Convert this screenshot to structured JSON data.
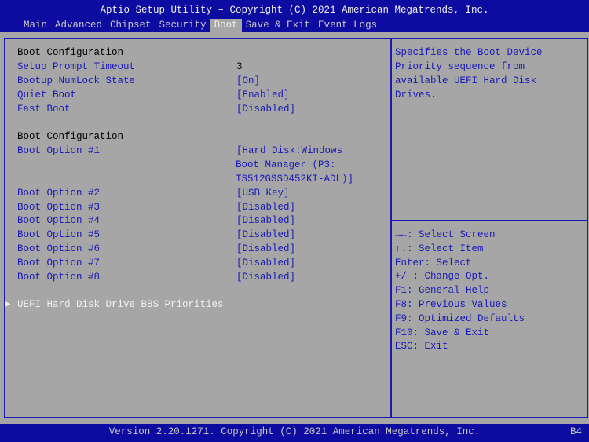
{
  "header": {
    "title": "Aptio Setup Utility – Copyright (C) 2021 American Megatrends, Inc.",
    "tabs": [
      "Main",
      "Advanced",
      "Chipset",
      "Security",
      "Boot",
      "Save & Exit",
      "Event Logs"
    ],
    "active_tab": "Boot"
  },
  "settings": [
    {
      "label": "Boot Configuration",
      "type": "heading"
    },
    {
      "label": "Setup Prompt Timeout",
      "value": "3"
    },
    {
      "label": "Bootup NumLock State",
      "value": "[On]"
    },
    {
      "label": "Quiet Boot",
      "value": "[Enabled]"
    },
    {
      "label": "Fast Boot",
      "value": "[Disabled]"
    },
    {
      "label": "Boot Configuration",
      "type": "heading"
    },
    {
      "label": "Boot Option #1",
      "value": "[Hard Disk:Windows",
      "value2": "Boot Manager (P3:",
      "value3": "TS512GSSD452KI-ADL)]"
    },
    {
      "label": "Boot Option #2",
      "value": "[USB Key]"
    },
    {
      "label": "Boot Option #3",
      "value": "[Disabled]"
    },
    {
      "label": "Boot Option #4",
      "value": "[Disabled]"
    },
    {
      "label": "Boot Option #5",
      "value": "[Disabled]"
    },
    {
      "label": "Boot Option #6",
      "value": "[Disabled]"
    },
    {
      "label": "Boot Option #7",
      "value": "[Disabled]"
    },
    {
      "label": "Boot Option #8",
      "value": "[Disabled]"
    }
  ],
  "submenu": {
    "arrow": "►",
    "label": "UEFI Hard Disk Drive BBS Priorities"
  },
  "help": [
    "Specifies the Boot Device",
    "Priority sequence from",
    "available UEFI Hard Disk",
    "Drives."
  ],
  "keys": [
    "→←: Select Screen",
    "↑↓: Select Item",
    "Enter: Select",
    "+/-: Change Opt.",
    "F1: General Help",
    "F8: Previous Values",
    "F9: Optimized Defaults",
    "F10: Save & Exit",
    "ESC: Exit"
  ],
  "footer": {
    "text": "Version 2.20.1271. Copyright (C) 2021 American Megatrends, Inc.",
    "code": "B4"
  },
  "colors": {
    "bar": "#0c0ca0",
    "background": "#a6a6a6",
    "option_text": "#1a1ab8"
  }
}
